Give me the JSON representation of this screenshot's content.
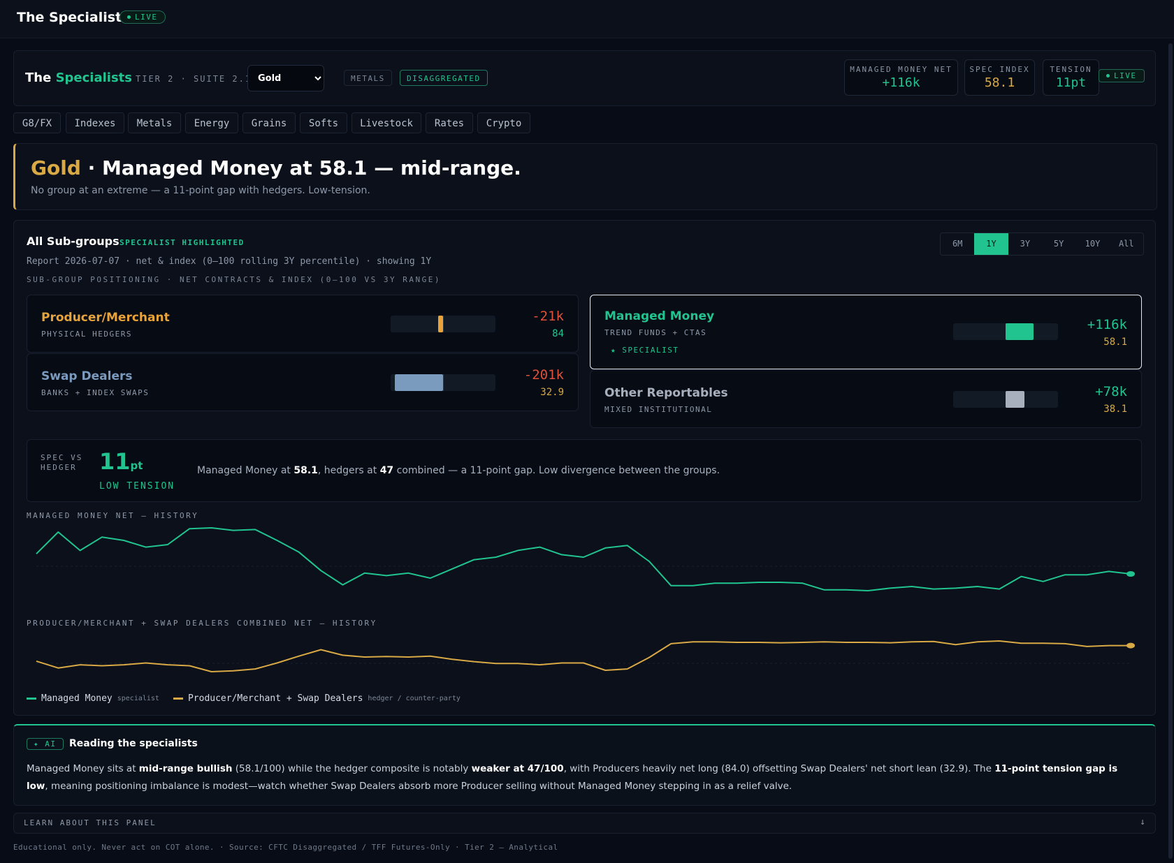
{
  "app": {
    "title": "The Specialists",
    "live": "LIVE"
  },
  "header": {
    "title_a": "The ",
    "title_b": "Specialists",
    "tier": "TIER 2 · SUITE 2.1",
    "asset": "Gold",
    "asset_options": [
      "Gold"
    ],
    "tag_metals": "METALS",
    "tag_disagg": "DISAGGREGATED",
    "stats": [
      {
        "label": "MANAGED MONEY NET",
        "value": "+116k",
        "color": "#21c48f"
      },
      {
        "label": "SPEC INDEX",
        "value": "58.1",
        "color": "#d8a944"
      },
      {
        "label": "TENSION",
        "value": "11pt",
        "color": "#21c48f"
      }
    ],
    "live": "LIVE"
  },
  "tabs": [
    "G8/FX",
    "Indexes",
    "Metals",
    "Energy",
    "Grains",
    "Softs",
    "Livestock",
    "Rates",
    "Crypto"
  ],
  "active_tab": "Metals",
  "banner": {
    "asset": "Gold",
    "headline": " · Managed Money at 58.1 — mid-range.",
    "sub": "No group at an extreme — a 11-point gap with hedgers. Low-tension."
  },
  "panel": {
    "title": "All Sub-groups",
    "highlight": "SPECIALIST HIGHLIGHTED",
    "report": "Report 2026-07-07 · net & index (0–100 rolling 3Y percentile) · showing 1Y",
    "section_label": "SUB-GROUP POSITIONING · NET CONTRACTS & INDEX (0–100 VS 3Y RANGE)",
    "ranges": [
      "6M",
      "1Y",
      "3Y",
      "5Y",
      "10Y",
      "All"
    ],
    "active_range": "1Y"
  },
  "groups": {
    "producer": {
      "name": "Producer/Merchant",
      "sub": "PHYSICAL HEDGERS",
      "net": "-21k",
      "index": "84",
      "net_value": -21,
      "color": "#e8a33a",
      "net_color": "#e0503a",
      "index_color": "#21c48f"
    },
    "swap": {
      "name": "Swap Dealers",
      "sub": "BANKS + INDEX SWAPS",
      "net": "-201k",
      "index": "32.9",
      "net_value": -201,
      "color": "#7b9bbe",
      "net_color": "#e0503a",
      "index_color": "#d8a944"
    },
    "managed": {
      "name": "Managed Money",
      "sub": "TREND FUNDS + CTAS",
      "badge": "★ SPECIALIST",
      "net": "+116k",
      "index": "58.1",
      "net_value": 116,
      "color": "#21c48f",
      "net_color": "#21c48f",
      "index_color": "#d8a944"
    },
    "other": {
      "name": "Other Reportables",
      "sub": "MIXED INSTITUTIONAL",
      "net": "+78k",
      "index": "38.1",
      "net_value": 78,
      "color": "#a9b0bd",
      "net_color": "#21c48f",
      "index_color": "#d8a944"
    }
  },
  "tension": {
    "label": "SPEC VS HEDGER",
    "value": "11",
    "unit": "pt",
    "level": "LOW TENSION",
    "text_a": "Managed Money at ",
    "mm_index": "58.1",
    "text_b": ", hedgers at ",
    "hedger_index": "47",
    "text_c": " combined — a 11-point gap. Low divergence between the groups."
  },
  "chart_data": [
    {
      "type": "line",
      "title": "MANAGED MONEY NET — HISTORY",
      "series": [
        {
          "name": "Managed Money",
          "color": "#21c48f",
          "values": [
            140,
            166,
            144,
            160,
            156,
            148,
            151,
            170,
            171,
            168,
            169,
            156,
            142,
            120,
            103,
            117,
            114,
            117,
            111,
            122,
            133,
            136,
            144,
            148,
            139,
            136,
            147,
            150,
            131,
            102,
            102,
            105,
            105,
            106,
            106,
            105,
            97,
            97,
            96,
            99,
            101,
            98,
            99,
            101,
            98,
            113,
            107,
            115,
            115,
            119,
            116
          ]
        }
      ]
    },
    {
      "type": "line",
      "title": "PRODUCER/MERCHANT + SWAP DEALERS COMBINED NET — HISTORY",
      "series": [
        {
          "name": "Producer/Merchant + Swap Dealers",
          "color": "#d8a944",
          "values": [
            -260,
            -275,
            -268,
            -270,
            -268,
            -264,
            -268,
            -270,
            -283,
            -281,
            -277,
            -264,
            -249,
            -235,
            -247,
            -251,
            -250,
            -251,
            -249,
            -256,
            -261,
            -265,
            -265,
            -268,
            -264,
            -264,
            -280,
            -277,
            -252,
            -222,
            -218,
            -218,
            -219,
            -219,
            -220,
            -219,
            -218,
            -219,
            -219,
            -220,
            -218,
            -217,
            -224,
            -218,
            -216,
            -221,
            -221,
            -222,
            -228,
            -226,
            -226
          ]
        }
      ]
    }
  ],
  "legend": {
    "mm": "Managed Money",
    "mm_sub": "specialist",
    "hedger": "Producer/Merchant + Swap Dealers",
    "hedger_sub": "hedger / counter-party"
  },
  "ai": {
    "pill": "✦ AI",
    "title": "Reading the specialists",
    "p1": "Managed Money sits at ",
    "b1": "mid-range bullish",
    "p2": " (58.1/100) while the hedger composite is notably ",
    "b2": "weaker at 47/100",
    "p3": ", with Producers heavily net long (84.0) offsetting Swap Dealers' net short lean (32.9). The ",
    "b3": "11-point tension gap is low",
    "p4": ", meaning positioning imbalance is modest—watch whether Swap Dealers absorb more Producer selling without Managed Money stepping in as a relief valve."
  },
  "learn": {
    "label": "LEARN ABOUT THIS PANEL",
    "arrow": "↓"
  },
  "footer": "Educational only. Never act on COT alone. · Source: CFTC Disaggregated / TFF Futures-Only · Tier 2 — Analytical"
}
